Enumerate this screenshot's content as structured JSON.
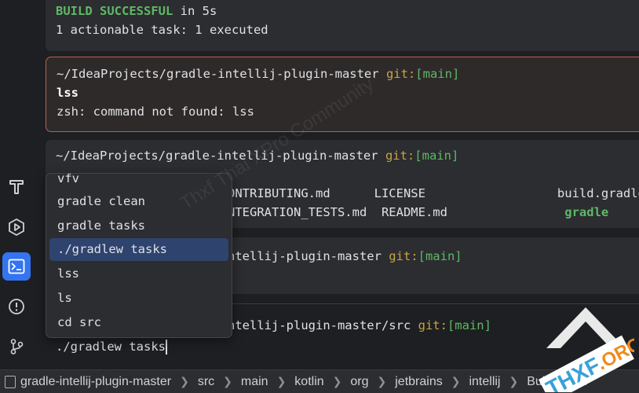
{
  "terminal": {
    "block1": {
      "status_prefix": "BUILD SUCCESSFUL",
      "status_suffix": " in 5s",
      "summary": "1 actionable task: 1 executed"
    },
    "block2": {
      "path": "~/IdeaProjects/gradle-intellij-plugin-master",
      "git_label": " git:",
      "branch": "[main]",
      "command": "lss",
      "output": "zsh: command not found: lss"
    },
    "block3": {
      "path": "~/IdeaProjects/gradle-intellij-plugin-master",
      "git_label": " git:",
      "branch": "[main]",
      "row1": "ONTRIBUTING.md      LICENSE                  build.gradle",
      "row2_text": "NTEGRATION_TESTS.md  README.md                ",
      "row2_dir": "gradle"
    },
    "block4": {
      "path": "ntellij-plugin-master",
      "git_label": " git:",
      "branch": "[main]"
    },
    "prompt": {
      "path": "ntellij-plugin-master/src",
      "git_label": " git:",
      "branch": "[main]",
      "input": "./gradlew tasks"
    }
  },
  "completion_popup": {
    "items": [
      "vfv",
      "gradle clean",
      "gradle tasks",
      "./gradlew tasks",
      "lss",
      "ls",
      "cd src"
    ],
    "selected": "./gradlew tasks"
  },
  "sidebar": {
    "icons": [
      "build-hammer-icon",
      "run-services-icon",
      "terminal-icon",
      "problems-icon",
      "git-branch-icon"
    ],
    "active": "terminal-icon"
  },
  "breadcrumb": [
    "gradle-intellij-plugin-master",
    "src",
    "main",
    "kotlin",
    "org",
    "jetbrains",
    "intellij",
    "BuildFeatu"
  ],
  "watermark": "Thxf Thai XPro Community",
  "logo": {
    "text_main": "THXF",
    "text_org": ".ORG"
  },
  "colors": {
    "background": "#1e1f22",
    "panel": "#2b2d30",
    "accent_blue": "#3574f0",
    "success_green": "#5fb865",
    "git_yellow": "#c9a342",
    "error_border": "#b9624c",
    "selection": "#2e436e"
  }
}
